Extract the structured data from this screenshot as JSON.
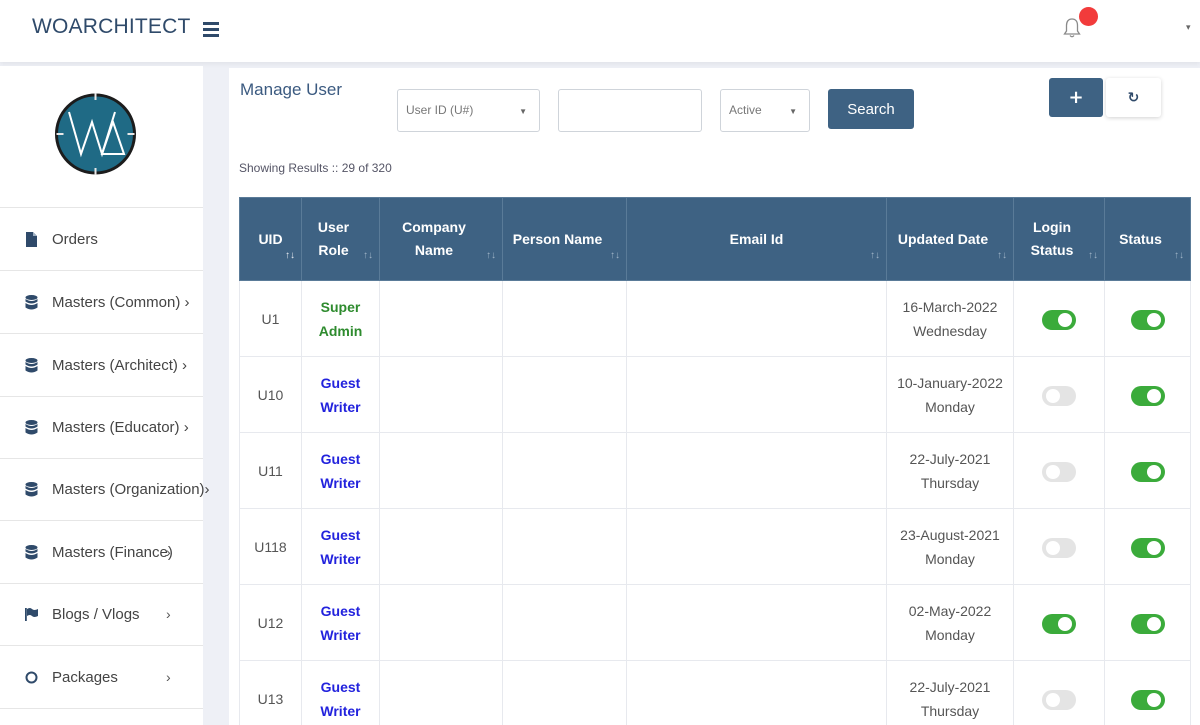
{
  "app": {
    "brand": "WOARCHITECT"
  },
  "header": {
    "notification_badge_color": "#f23b3b",
    "profile_caret": "▾"
  },
  "sidebar": {
    "items": [
      {
        "label": "Orders",
        "icon": "file-icon",
        "chevron": ""
      },
      {
        "label": "Masters (Common) ›",
        "icon": "database-icon",
        "chevron": ""
      },
      {
        "label": "Masters (Architect) ›",
        "icon": "database-icon",
        "chevron": ""
      },
      {
        "label": "Masters (Educator) ›",
        "icon": "database-icon",
        "chevron": ""
      },
      {
        "label": "Masters (Organization)›",
        "icon": "database-icon",
        "chevron": ""
      },
      {
        "label": "Masters (Finance)",
        "icon": "database-icon",
        "chevron": "›"
      },
      {
        "label": "Blogs / Vlogs",
        "icon": "flag-icon",
        "chevron": "›"
      },
      {
        "label": "Packages",
        "icon": "circle-icon",
        "chevron": "›"
      }
    ]
  },
  "main": {
    "title": "Manage User",
    "filters": {
      "field_select": "User ID (U#)",
      "search_value": "",
      "status_select": "Active",
      "search_button": "Search",
      "add_button": "+",
      "refresh_button": "↻"
    },
    "results_text": "Showing Results :: 29 of 320",
    "table": {
      "columns": [
        {
          "label": "UID",
          "sort": "↑↓"
        },
        {
          "label": "User Role",
          "sort": "↑↓"
        },
        {
          "label": "Company Name",
          "sort": "↑↓"
        },
        {
          "label": "Person Name",
          "sort": "↑↓"
        },
        {
          "label": "Email Id",
          "sort": "↑↓"
        },
        {
          "label": "Updated Date",
          "sort": "↑↓"
        },
        {
          "label": "Login Status",
          "sort": "↑↓"
        },
        {
          "label": "Status",
          "sort": "↑↓"
        }
      ],
      "rows": [
        {
          "uid": "U1",
          "role": "Super Admin",
          "company": "",
          "person": "",
          "email": "",
          "date": "16-March-2022",
          "day": "Wednesday",
          "login_on": true,
          "status_on": true
        },
        {
          "uid": "U10",
          "role": "Guest Writer",
          "company": "",
          "person": "",
          "email": "",
          "date": "10-January-2022",
          "day": "Monday",
          "login_on": false,
          "status_on": true
        },
        {
          "uid": "U11",
          "role": "Guest Writer",
          "company": "",
          "person": "",
          "email": "",
          "date": "22-July-2021",
          "day": "Thursday",
          "login_on": false,
          "status_on": true
        },
        {
          "uid": "U118",
          "role": "Guest Writer",
          "company": "",
          "person": "",
          "email": "",
          "date": "23-August-2021",
          "day": "Monday",
          "login_on": false,
          "status_on": true
        },
        {
          "uid": "U12",
          "role": "Guest Writer",
          "company": "",
          "person": "",
          "email": "",
          "date": "02-May-2022",
          "day": "Monday",
          "login_on": true,
          "status_on": true
        },
        {
          "uid": "U13",
          "role": "Guest Writer",
          "company": "",
          "person": "",
          "email": "",
          "date": "22-July-2021",
          "day": "Thursday",
          "login_on": false,
          "status_on": true
        }
      ]
    }
  },
  "colors": {
    "primary": "#3e6283",
    "toggle_on": "#3bab3b",
    "toggle_off": "#e4e4e4",
    "super_admin": "#2e8b2e",
    "guest_writer": "#2222dd"
  }
}
